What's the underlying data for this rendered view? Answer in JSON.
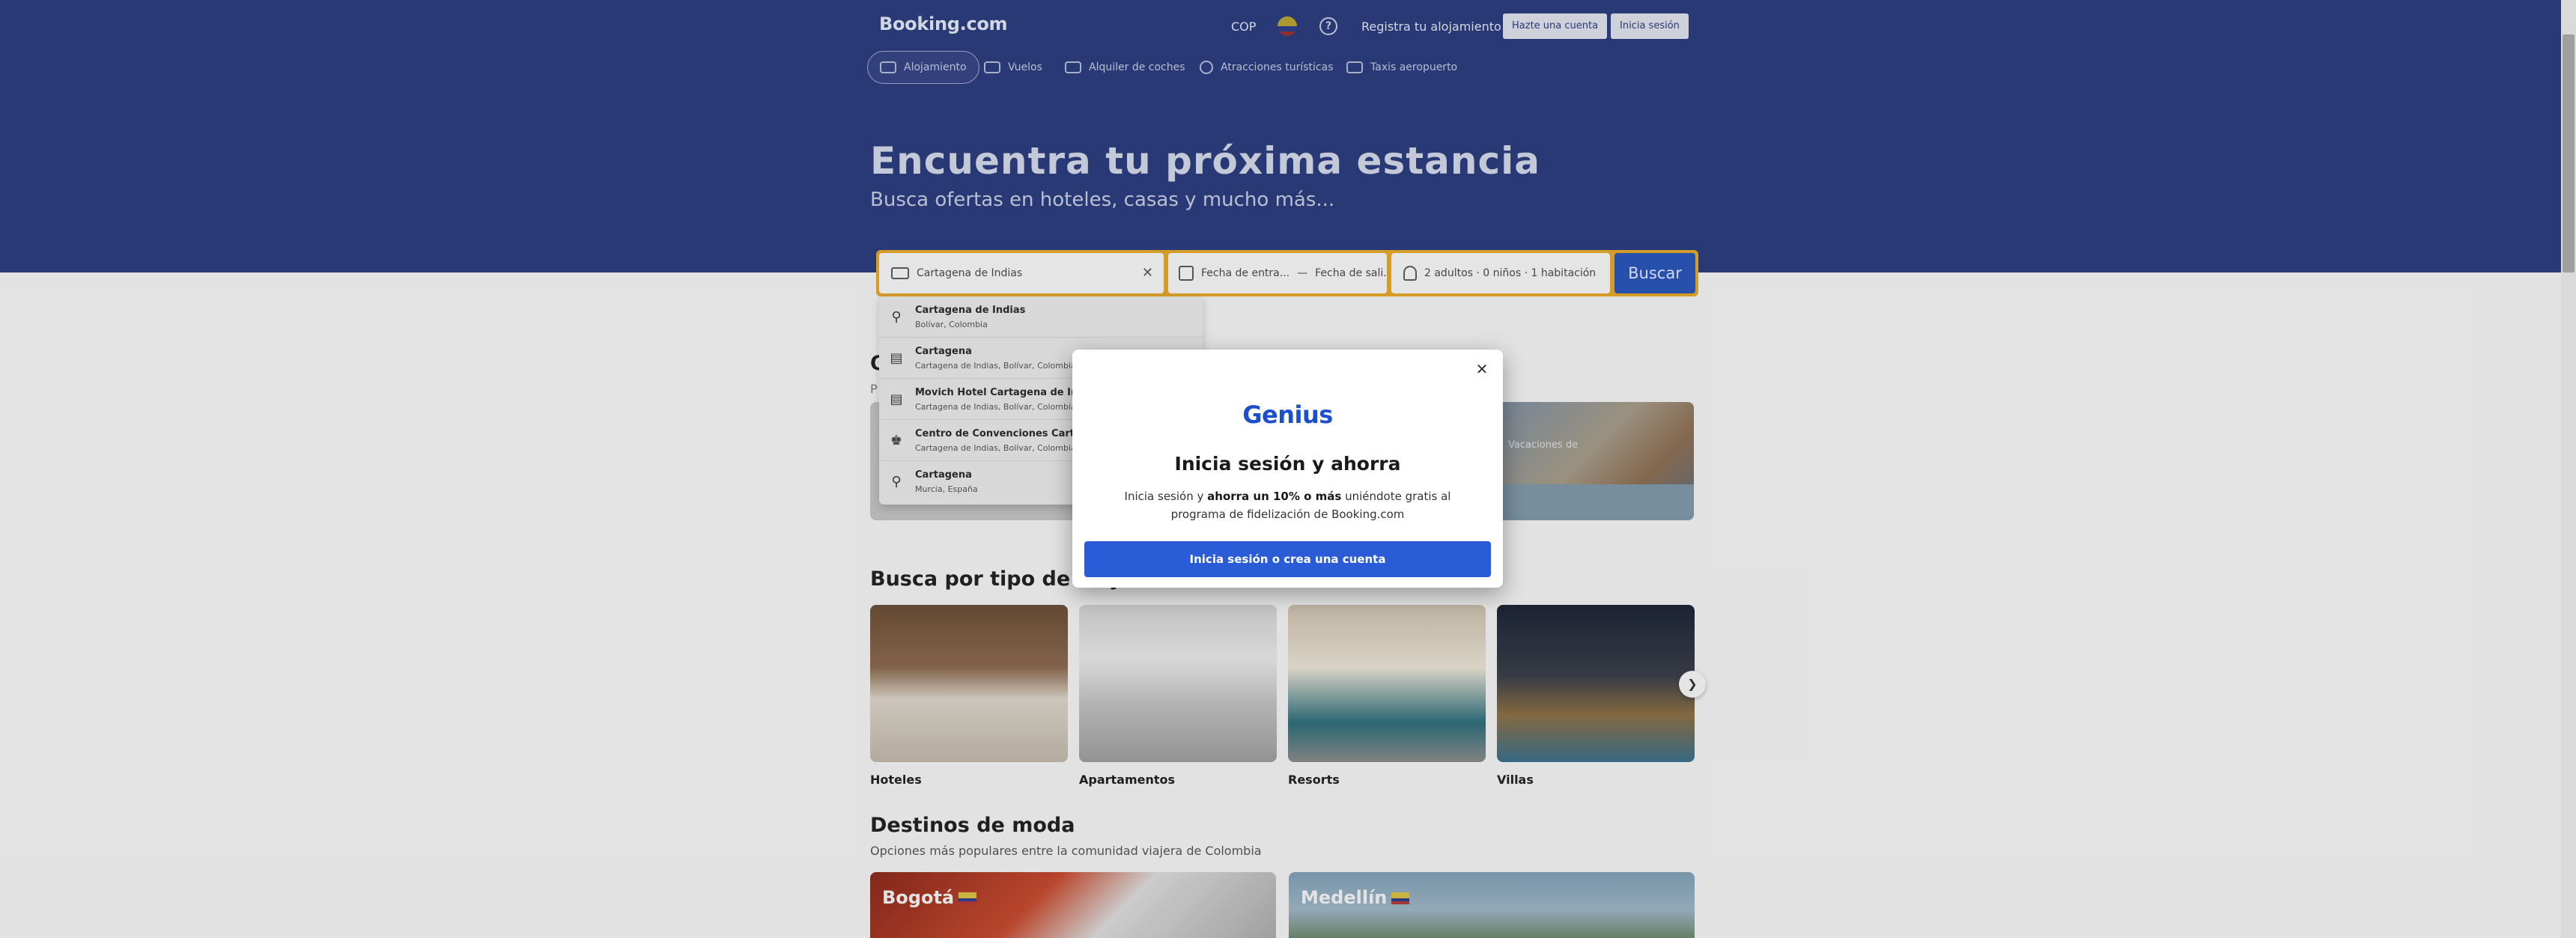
{
  "header": {
    "logo": "Booking.com",
    "currency": "COP",
    "help_icon": "question-circle-icon",
    "register_property": "Registra tu alojamiento",
    "create_account": "Hazte una cuenta",
    "sign_in": "Inicia sesión"
  },
  "nav": {
    "items": [
      {
        "label": "Alojamiento",
        "icon": "bed-icon",
        "active": true
      },
      {
        "label": "Vuelos",
        "icon": "plane-icon"
      },
      {
        "label": "Alquiler de coches",
        "icon": "car-icon"
      },
      {
        "label": "Atracciones turísticas",
        "icon": "attractions-icon"
      },
      {
        "label": "Taxis aeropuerto",
        "icon": "taxi-icon"
      }
    ]
  },
  "hero": {
    "title": "Encuentra tu próxima estancia",
    "subtitle": "Busca ofertas en hoteles, casas y mucho más..."
  },
  "search": {
    "destination_value": "Cartagena de Indias",
    "checkin_placeholder": "Fecha de entra...",
    "date_separator": "—",
    "checkout_placeholder": "Fecha de sali...",
    "guests": "2 adultos · 0 niños · 1 habitación",
    "submit": "Buscar"
  },
  "suggestions": [
    {
      "title": "Cartagena de Indias",
      "subtitle": "Bolívar, Colombia",
      "icon": "map-pin-icon"
    },
    {
      "title": "Cartagena",
      "subtitle": "Cartagena de Indias, Bolívar, Colombia",
      "icon": "bed-icon"
    },
    {
      "title": "Movich Hotel Cartagena de Indi",
      "subtitle": "Cartagena de Indias, Bolívar, Colombia",
      "icon": "bed-icon"
    },
    {
      "title": "Centro de Convenciones Cartage",
      "subtitle": "Cartagena de Indias, Bolívar, Colombia",
      "icon": "building-icon"
    },
    {
      "title": "Cartagena",
      "subtitle": "Murcia, España",
      "icon": "map-pin-icon"
    }
  ],
  "partial": {
    "heading_fragment": "O",
    "sub_fragment": "P",
    "offer_text_fragment": "Vacaciones de"
  },
  "property_types": {
    "heading": "Busca por tipo de aloja",
    "items": [
      {
        "label": "Hoteles"
      },
      {
        "label": "Apartamentos"
      },
      {
        "label": "Resorts"
      },
      {
        "label": "Villas"
      }
    ]
  },
  "trending": {
    "heading": "Destinos de moda",
    "subtitle": "Opciones más populares entre la comunidad viajera de Colombia",
    "destinations": [
      {
        "name": "Bogotá"
      },
      {
        "name": "Medellín"
      }
    ]
  },
  "modal": {
    "brand": "Genius",
    "title": "Inicia sesión y ahorra",
    "text_pre": "Inicia sesión y ",
    "text_bold": "ahorra un 10% o más",
    "text_post": " uniéndote gratis al programa de fidelización de Booking.com",
    "cta": "Inicia sesión o crea una cuenta"
  },
  "colors": {
    "brand_blue": "#2c3d7d",
    "search_border": "#e3a72b",
    "button_blue": "#2a5cd8",
    "genius_blue": "#1b4fd0"
  }
}
